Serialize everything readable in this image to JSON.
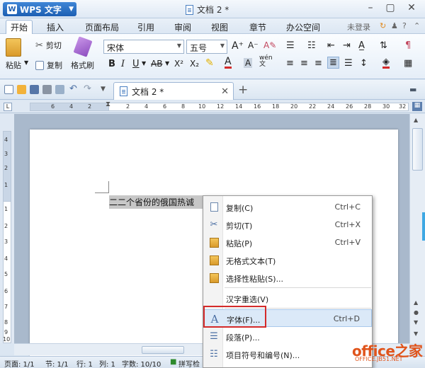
{
  "app": {
    "name": "WPS 文字",
    "doc_title": "文档 2 *"
  },
  "tabs": [
    "开始",
    "插入",
    "页面布局",
    "引用",
    "审阅",
    "视图",
    "章节",
    "办公空间"
  ],
  "tab_right": {
    "login": "未登录"
  },
  "ribbon": {
    "paste": "粘贴",
    "cut": "剪切",
    "copy": "复制",
    "format_painter": "格式刷",
    "font": "宋体",
    "size": "五号"
  },
  "doc_tab": {
    "title": "文档 2 *"
  },
  "ruler": {
    "numbers": [
      "6",
      "4",
      "2",
      "2",
      "4",
      "6",
      "8",
      "10",
      "12",
      "14",
      "16",
      "18",
      "20",
      "22",
      "24",
      "26",
      "28",
      "30",
      "32"
    ],
    "vnumbers": [
      "4",
      "3",
      "2",
      "1",
      "1",
      "2",
      "3",
      "4",
      "5",
      "6",
      "7",
      "8",
      "9",
      "10"
    ]
  },
  "document": {
    "selected_text": "二二个省份的俄国热诚"
  },
  "context_menu": [
    {
      "label": "复制(C)",
      "shortcut": "Ctrl+C",
      "icon": "copy-icon"
    },
    {
      "label": "剪切(T)",
      "shortcut": "Ctrl+X",
      "icon": "scissors-icon"
    },
    {
      "label": "粘贴(P)",
      "shortcut": "Ctrl+V",
      "icon": "paste-icon"
    },
    {
      "label": "无格式文本(T)",
      "shortcut": "",
      "icon": "paste-text-icon"
    },
    {
      "label": "选择性粘贴(S)...",
      "shortcut": "",
      "icon": "paste-special-icon"
    },
    {
      "label": "汉字重选(V)",
      "shortcut": "",
      "icon": ""
    },
    {
      "label": "字体(F)...",
      "shortcut": "Ctrl+D",
      "icon": "font-icon"
    },
    {
      "label": "段落(P)...",
      "shortcut": "",
      "icon": "paragraph-icon"
    },
    {
      "label": "项目符号和编号(N)...",
      "shortcut": "",
      "icon": "list-icon"
    }
  ],
  "status": {
    "page": "页面: 1/1",
    "section": "节: 1/1",
    "row": "行: 1",
    "col": "列: 1",
    "words": "字数: 10/10",
    "spell": "拼写检"
  },
  "watermark": {
    "brand": "office之家",
    "url": "OFFICE.JB51.NET"
  }
}
